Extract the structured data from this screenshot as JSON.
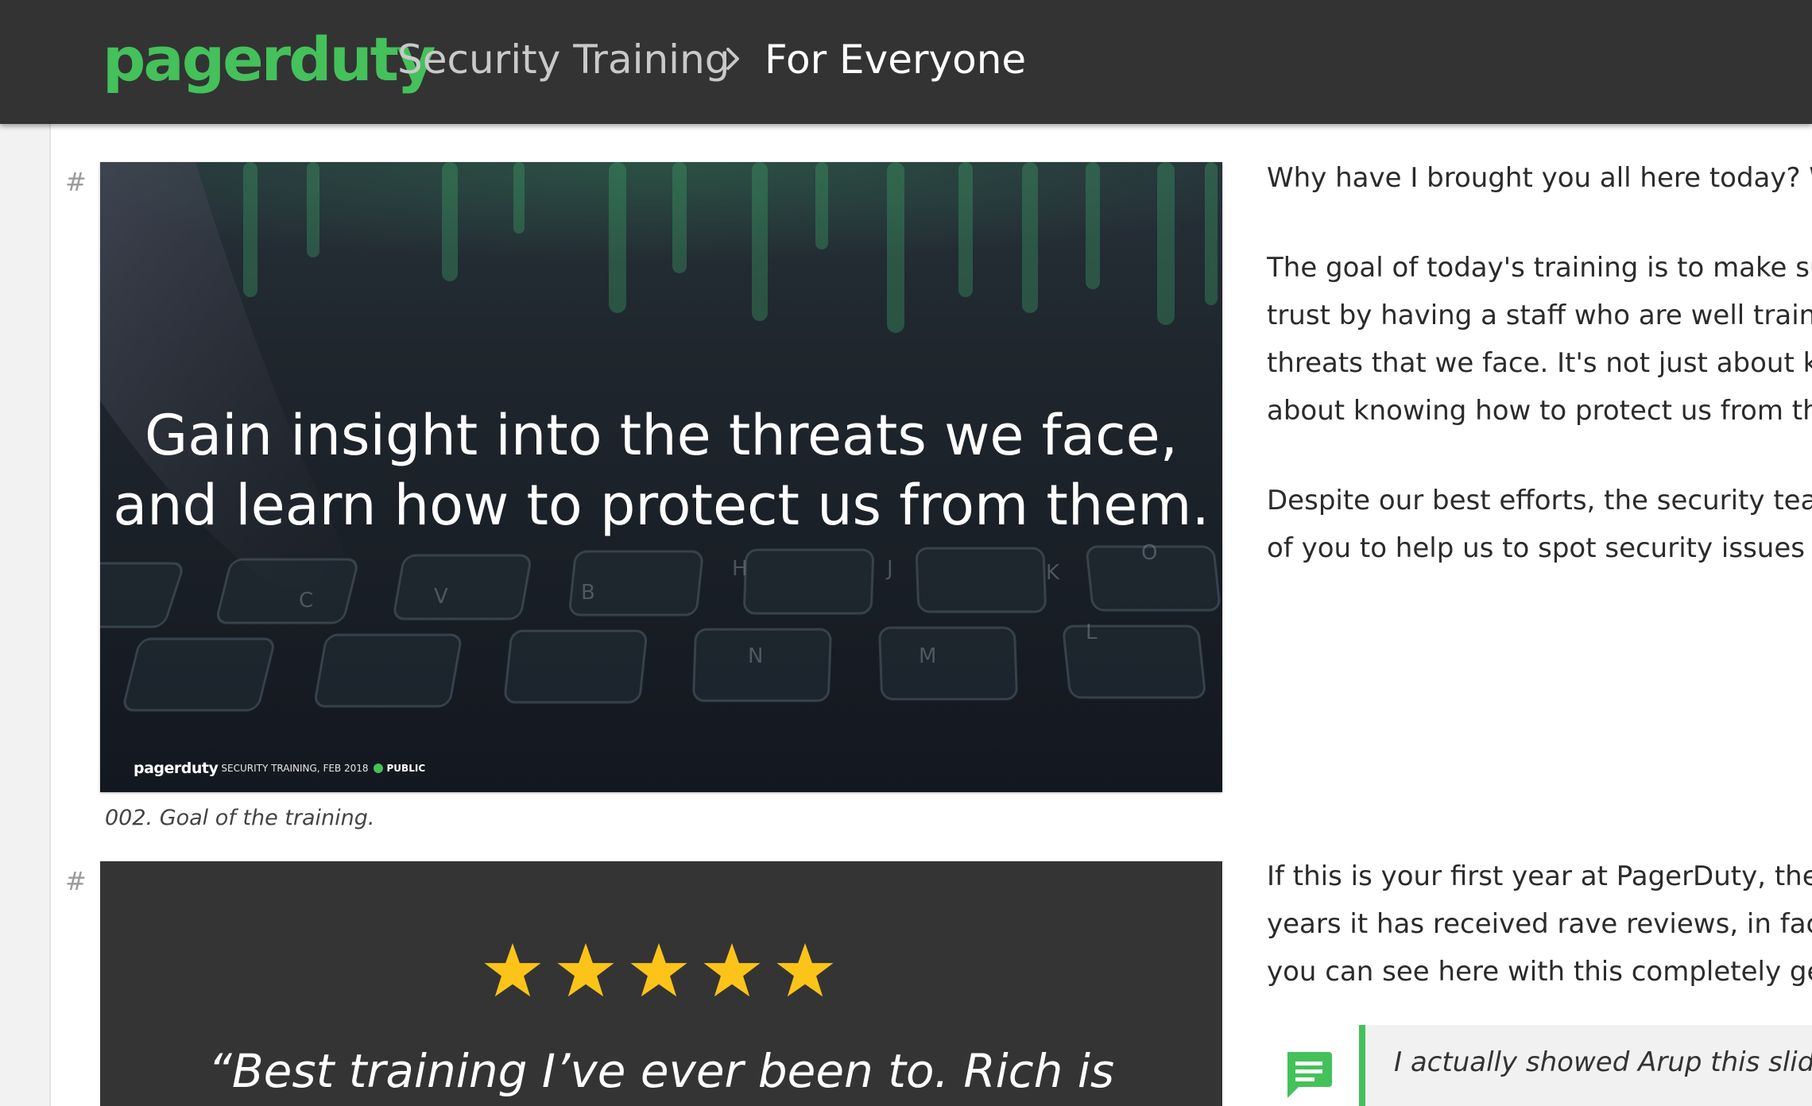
{
  "header": {
    "logo": "pagerduty",
    "breadcrumb_root": "Security Training",
    "breadcrumb_current": "For Everyone"
  },
  "anchor_symbol": "#",
  "slides": [
    {
      "heading_lines": [
        "Gain insight into the threats we face,",
        "and learn how to protect us from them."
      ],
      "footer": {
        "logo": "pagerduty",
        "meta": "SECURITY TRAINING, FEB 2018",
        "classification": "PUBLIC"
      },
      "caption": "002. Goal of the training.",
      "notes": [
        [
          "Why have I brought you all here today? Wh"
        ],
        [
          "The goal of today's training is to make sur",
          "trust by having a staff who are well trainin",
          "threats that we face. It's not just about kn",
          "about knowing how to protect us from tho"
        ],
        [
          "Despite our best efforts, the security team",
          "of you to help us to spot security issues a"
        ]
      ]
    },
    {
      "rating": 5,
      "quote": "“Best training I’ve ever been to. Rich is",
      "notes": [
        "If this is your first year at PagerDuty, then",
        "years it has received rave reviews, in fact",
        "you can see here with this completely gen"
      ],
      "comment": "I actually showed Arup this slide"
    }
  ],
  "colors": {
    "header_bg": "#333333",
    "brand_green": "#44c15a",
    "star_yellow": "#fcc419"
  }
}
